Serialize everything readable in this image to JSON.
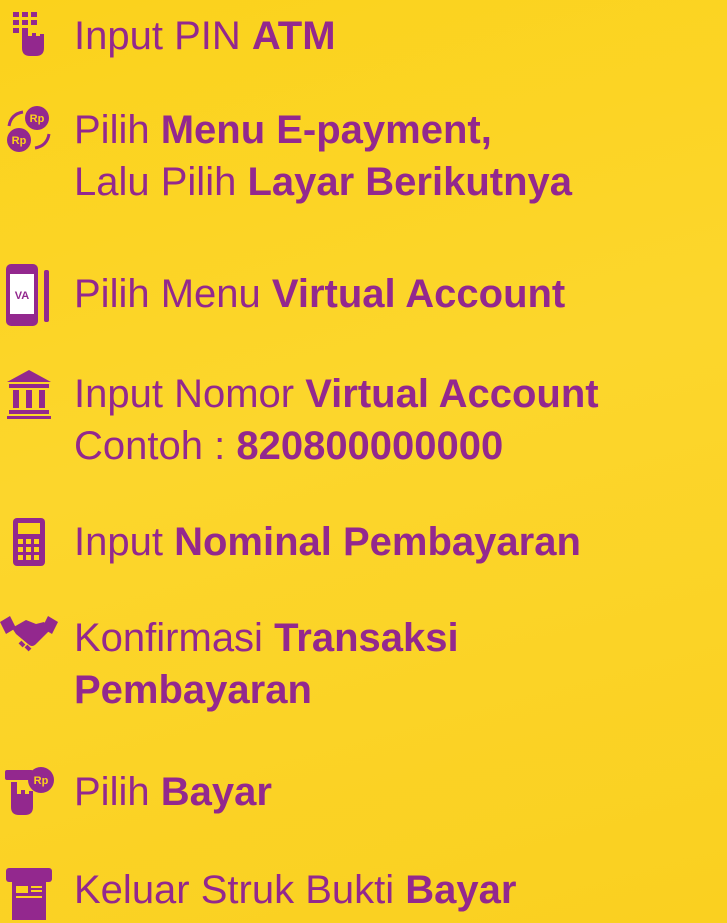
{
  "brand_color": "#93288e",
  "background_color": "#fbd21c",
  "steps": [
    {
      "icon": "pin-pad-finger-icon",
      "light": "Input PIN ",
      "bold": "ATM"
    },
    {
      "icon": "rupiah-exchange-icon",
      "light": "Pilih ",
      "bold": "Menu E-payment,",
      "light2": "Lalu Pilih ",
      "bold2": "Layar Berikutnya"
    },
    {
      "icon": "virtual-account-phone-icon",
      "light": "Pilih Menu ",
      "bold": "Virtual Account"
    },
    {
      "icon": "bank-building-icon",
      "light": "Input Nomor ",
      "bold": "Virtual Account",
      "light2": "Contoh : ",
      "bold2": "820800000000"
    },
    {
      "icon": "calculator-icon",
      "light": "Input ",
      "bold": "Nominal Pembayaran"
    },
    {
      "icon": "handshake-icon",
      "light": "Konfirmasi ",
      "bold": "Transaksi",
      "light2": "",
      "bold2": "Pembayaran"
    },
    {
      "icon": "tap-pay-rupiah-icon",
      "light": "Pilih ",
      "bold": "Bayar"
    },
    {
      "icon": "receipt-printer-icon",
      "light": "Keluar Struk Bukti ",
      "bold": "Bayar"
    }
  ]
}
